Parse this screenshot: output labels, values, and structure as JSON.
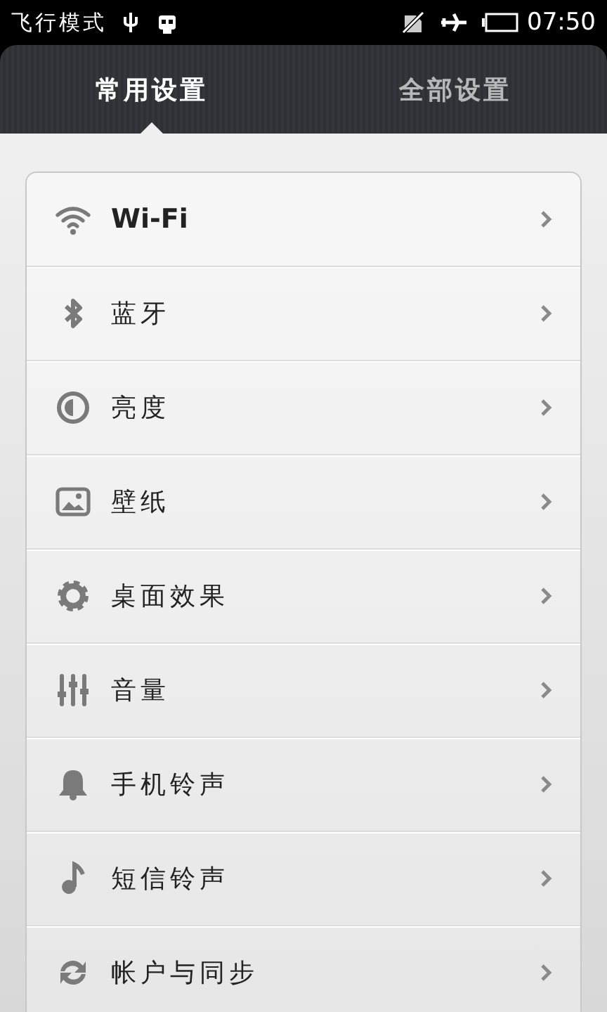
{
  "status_bar": {
    "notification": "飞行模式",
    "time": "07:50"
  },
  "tabs": [
    {
      "label": "常用设置",
      "selected": true
    },
    {
      "label": "全部设置",
      "selected": false
    }
  ],
  "settings": [
    {
      "kind": "wifi",
      "label": "Wi-Fi"
    },
    {
      "kind": "bluetooth",
      "label": "蓝牙"
    },
    {
      "kind": "brightness",
      "label": "亮度"
    },
    {
      "kind": "wallpaper",
      "label": "壁纸"
    },
    {
      "kind": "desktop",
      "label": "桌面效果"
    },
    {
      "kind": "volume",
      "label": "音量"
    },
    {
      "kind": "ringtone",
      "label": "手机铃声"
    },
    {
      "kind": "sms",
      "label": "短信铃声"
    },
    {
      "kind": "sync",
      "label": "帐户与同步"
    }
  ]
}
